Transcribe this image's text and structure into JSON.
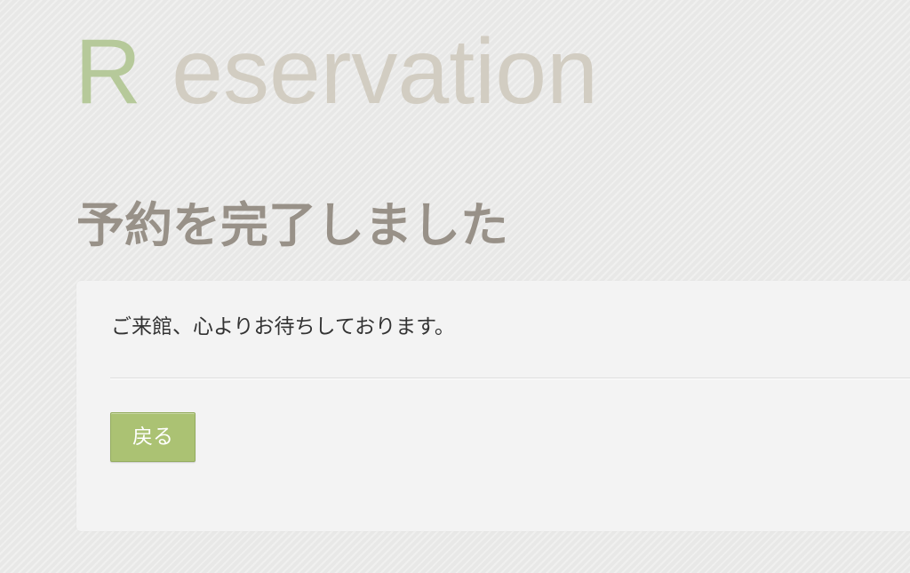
{
  "header": {
    "brand_initial": "R",
    "brand_rest": "eservation"
  },
  "main": {
    "title": "予約を完了しました",
    "message": "ご来館、心よりお待ちしております。",
    "back_button_label": "戻る"
  },
  "colors": {
    "brand_initial": "#b6c99a",
    "brand_rest": "#d2cdc2",
    "title": "#989188",
    "panel_bg": "#f3f3f3",
    "button_bg": "#abc273",
    "text": "#333333"
  }
}
